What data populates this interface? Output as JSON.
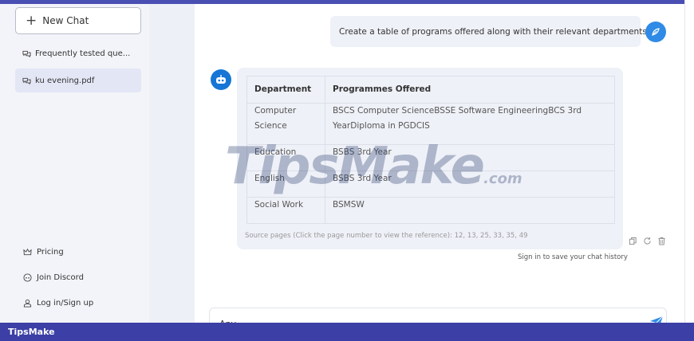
{
  "sidebar": {
    "new_chat_label": "New Chat",
    "items": [
      {
        "label": "Frequently tested que...",
        "icon": "chat-bubbles-icon",
        "active": false
      },
      {
        "label": "ku evening.pdf",
        "icon": "chat-bubbles-icon",
        "active": true
      }
    ],
    "bottom_links": [
      {
        "label": "Pricing",
        "icon": "crown-icon"
      },
      {
        "label": "Join Discord",
        "icon": "discord-icon"
      },
      {
        "label": "Log in/Sign up",
        "icon": "user-icon"
      }
    ]
  },
  "chat": {
    "user_message": "Create a table of programs offered along with their relevant departments.",
    "table": {
      "headers": [
        "Department",
        "Programmes Offered"
      ],
      "rows": [
        [
          "Computer Science",
          "BSCS Computer ScienceBSSE Software EngineeringBCS 3rd YearDiploma in PGDCIS"
        ],
        [
          "Education",
          "BSBS 3rd Year"
        ],
        [
          "English",
          "BSBS 3rd Year"
        ],
        [
          "Social Work",
          "BSMSW"
        ]
      ]
    },
    "source_line": "Source pages (Click the page number to view the reference): 12, 13, 25, 33, 35, 49",
    "sign_in_note": "Sign in to save your chat history"
  },
  "input": {
    "value": "Any"
  },
  "watermark": {
    "brand": "TipsMake",
    "suffix": ".com"
  },
  "footer": {
    "brand": "TipsMake"
  },
  "colors": {
    "accent": "#2f8be6",
    "footer_bg": "#3b3fa6",
    "bubble_bg": "#eff1f8"
  }
}
